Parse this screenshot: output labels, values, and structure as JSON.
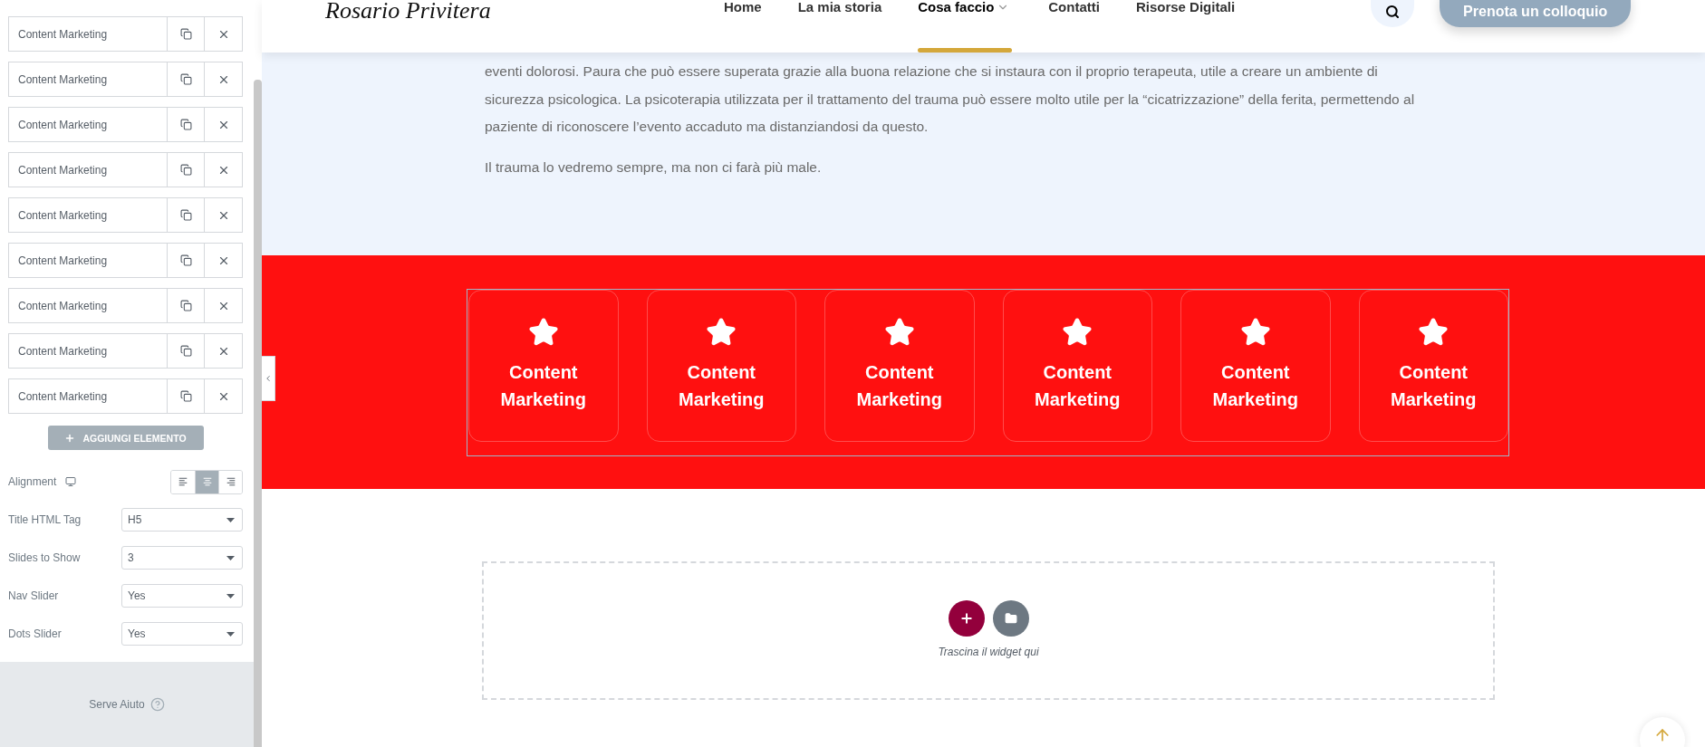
{
  "panel": {
    "items": [
      {
        "label": "Content Marketing"
      },
      {
        "label": "Content Marketing"
      },
      {
        "label": "Content Marketing"
      },
      {
        "label": "Content Marketing"
      },
      {
        "label": "Content Marketing"
      },
      {
        "label": "Content Marketing"
      },
      {
        "label": "Content Marketing"
      },
      {
        "label": "Content Marketing"
      },
      {
        "label": "Content Marketing"
      }
    ],
    "add_button": "AGGIUNGI ELEMENTO",
    "alignment": {
      "label": "Alignment",
      "options": [
        {
          "kind": "left",
          "selected": false
        },
        {
          "kind": "center",
          "selected": true
        },
        {
          "kind": "right",
          "selected": false
        }
      ]
    },
    "fields": [
      {
        "label": "Title HTML Tag",
        "value": "H5"
      },
      {
        "label": "Slides to Show",
        "value": "3"
      },
      {
        "label": "Nav Slider",
        "value": "Yes"
      },
      {
        "label": "Dots Slider",
        "value": "Yes"
      }
    ],
    "help": "Serve Aiuto"
  },
  "header": {
    "logo": "Rosario Privitera",
    "nav": [
      {
        "label": "Home",
        "selected": false,
        "dropdown": false
      },
      {
        "label": "La mia storia",
        "selected": false,
        "dropdown": false
      },
      {
        "label": "Cosa faccio",
        "selected": true,
        "dropdown": true
      },
      {
        "label": "Contatti",
        "selected": false,
        "dropdown": false
      },
      {
        "label": "Risorse Digitali",
        "selected": false,
        "dropdown": false
      }
    ],
    "cta": "Prenota un colloquio"
  },
  "article": {
    "paragraphs": [
      "eventi dolorosi. Paura che può essere superata grazie alla buona relazione che si instaura con il proprio terapeuta, utile a creare un ambiente di sicurezza psicologica. La psicoterapia utilizzata per il trattamento del trauma può essere molto utile per la “cicatrizzazione” della ferita, permettendo al paziente di riconoscere l’evento accaduto ma distanziandosi da questo.",
      "Il trauma lo vedremo sempre, ma non ci farà più male."
    ]
  },
  "cards": [
    {
      "title": "Content Marketing"
    },
    {
      "title": "Content Marketing"
    },
    {
      "title": "Content Marketing"
    },
    {
      "title": "Content Marketing"
    },
    {
      "title": "Content Marketing"
    },
    {
      "title": "Content Marketing"
    }
  ],
  "drop_zone": {
    "hint": "Trascina il widget qui"
  }
}
